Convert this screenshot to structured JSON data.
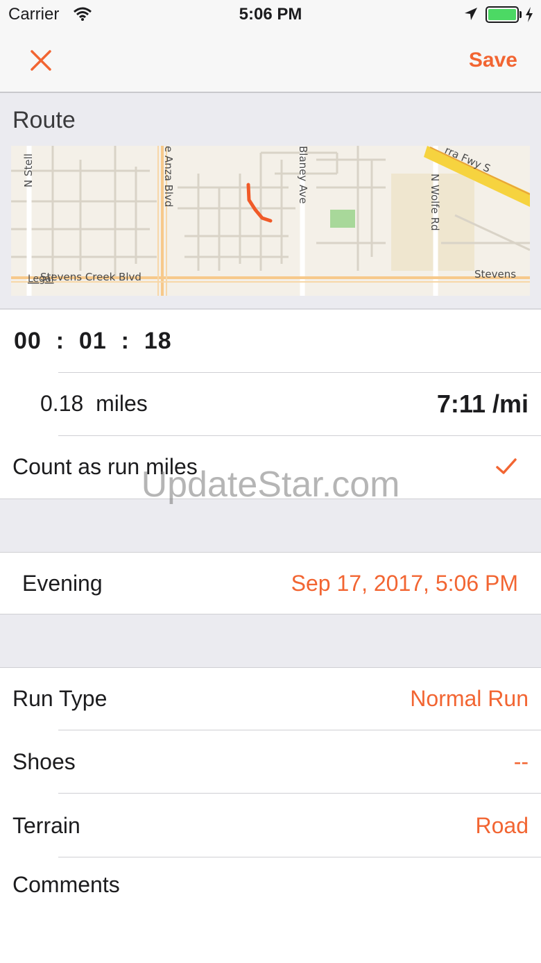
{
  "status_bar": {
    "carrier": "Carrier",
    "time": "5:06 PM",
    "battery_color": "#4cd964"
  },
  "nav": {
    "close_icon": "close-icon",
    "save_label": "Save",
    "accent_color": "#f26532"
  },
  "route": {
    "title": "Route",
    "map": {
      "street_labels": [
        "N Stell",
        "e Anza Blvd",
        "Blaney Ave",
        "N Wolfe Rd",
        "rra Fwy S",
        "Stevens Creek Blvd",
        "Stevens"
      ],
      "legal_label": "Legal"
    }
  },
  "run": {
    "duration": "00  :  01  :  18",
    "distance": "0.18  miles",
    "pace": "7:11 /mi",
    "count_label": "Count as run miles",
    "count_checked": true
  },
  "date": {
    "label": "Evening",
    "value": "Sep 17, 2017, 5:06 PM"
  },
  "details": {
    "run_type_label": "Run Type",
    "run_type_value": "Normal Run",
    "shoes_label": "Shoes",
    "shoes_value": "--",
    "terrain_label": "Terrain",
    "terrain_value": "Road",
    "comments_label": "Comments"
  },
  "watermark": "UpdateStar.com"
}
